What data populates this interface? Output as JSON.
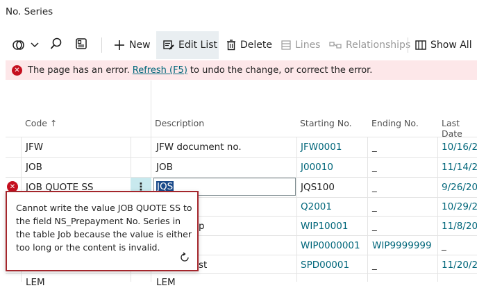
{
  "page": {
    "title": "No. Series"
  },
  "toolbar": {
    "new_label": "New",
    "edit_list_label": "Edit List",
    "delete_label": "Delete",
    "lines_label": "Lines",
    "relationships_label": "Relationships",
    "show_all_label": "Show All"
  },
  "error_bar": {
    "prefix": "The page has an error.",
    "link": "Refresh (F5)",
    "suffix": "to undo the change, or correct the error."
  },
  "table": {
    "columns": {
      "code": "Code ↑",
      "description": "Description",
      "starting_no": "Starting No.",
      "ending_no": "Ending No.",
      "last_date": "Last Date"
    },
    "rows": [
      {
        "code": "JFW",
        "description": "JFW document no.",
        "starting_no": "JFW0001",
        "ending_no": "_",
        "last_date": "10/16/2"
      },
      {
        "code": "JOB",
        "description": "JOB",
        "starting_no": "J00010",
        "ending_no": "_",
        "last_date": "11/14/2"
      },
      {
        "code": "JOB QUOTE SS",
        "description": "JQS",
        "starting_no": "JQS100",
        "ending_no": "_",
        "last_date": "9/26/20"
      },
      {
        "code": "",
        "description": "",
        "starting_no": "Q2001",
        "ending_no": "_",
        "last_date": "10/29/2"
      },
      {
        "code": "",
        "description": "p",
        "starting_no": "WIP10001",
        "ending_no": "_",
        "last_date": "11/8/20"
      },
      {
        "code": "",
        "description": "",
        "starting_no": "WIP0000001",
        "ending_no": "WIP9999999",
        "last_date": "_"
      },
      {
        "code": "",
        "description": "st",
        "starting_no": "SPD00001",
        "ending_no": "_",
        "last_date": "11/20/2"
      }
    ],
    "partial_row": {
      "code": "LEM",
      "description": "LEM"
    }
  },
  "error_popup": {
    "message": "Cannot write the value JOB QUOTE SS to the field NS_Prepayment No. Series in the table Job because the value is either too long or the content is invalid."
  },
  "colors": {
    "accent": "#00667a",
    "error": "#c50f1f",
    "error_bg": "#fde7e9",
    "selection": "#1a4a8a"
  }
}
